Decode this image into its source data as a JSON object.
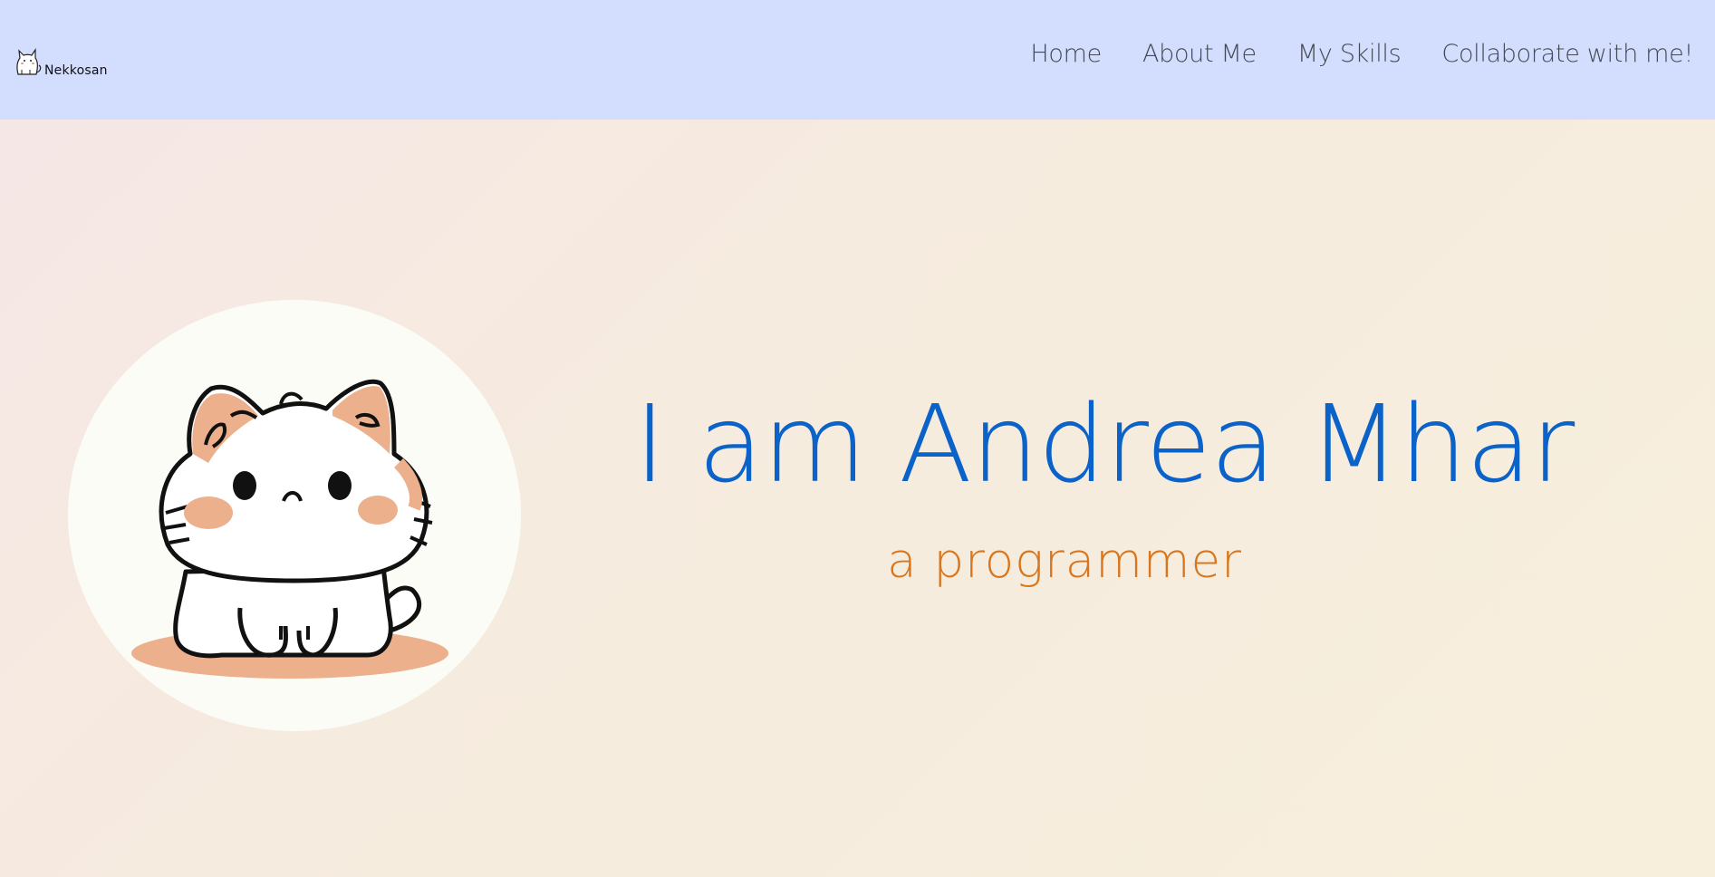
{
  "brand": {
    "name": "Nekkosan",
    "logo_icon": "cat-logo-icon"
  },
  "nav": {
    "items": [
      {
        "label": "Home"
      },
      {
        "label": "About Me"
      },
      {
        "label": "My Skills"
      },
      {
        "label": "Collaborate with me!"
      }
    ]
  },
  "hero": {
    "title": "I am Andrea Mhar",
    "subtitle": "a programmer",
    "avatar_icon": "kawaii-cat-illustration"
  },
  "colors": {
    "navbar_bg": "#d3ddfd",
    "title": "#0b62c9",
    "subtitle": "#d9761d",
    "nav_text": "#444a55"
  }
}
